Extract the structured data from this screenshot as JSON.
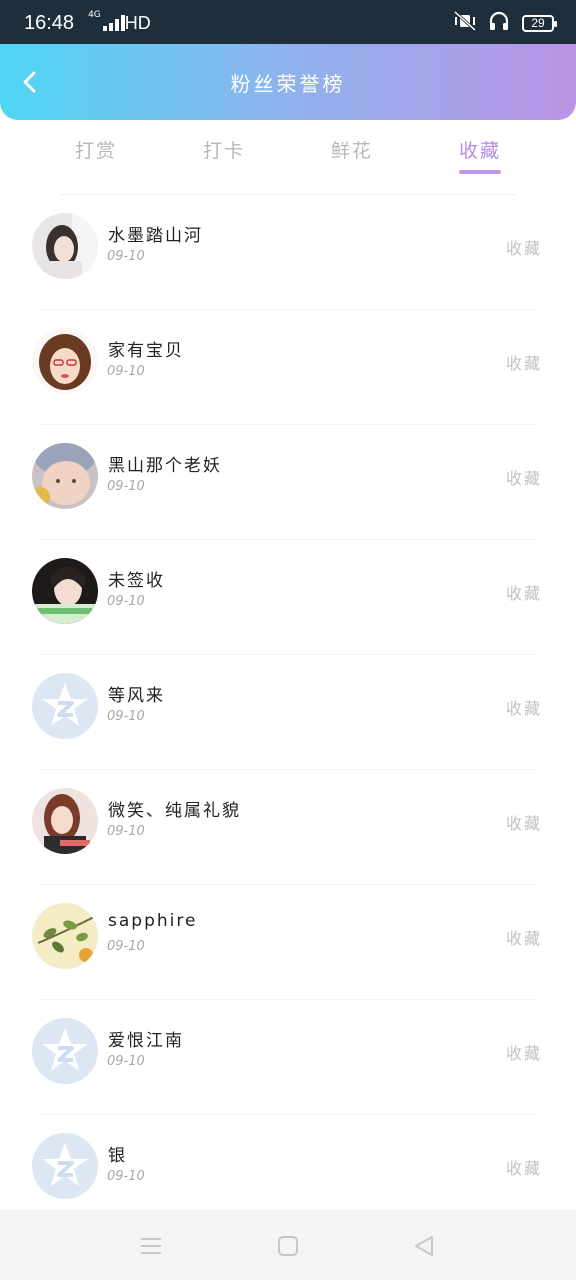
{
  "status_bar": {
    "time": "16:48",
    "network": "4G",
    "hd": "HD",
    "battery": "29"
  },
  "header": {
    "title": "粉丝荣誉榜"
  },
  "tabs": [
    {
      "label": "打赏",
      "active": false
    },
    {
      "label": "打卡",
      "active": false
    },
    {
      "label": "鲜花",
      "active": false
    },
    {
      "label": "收藏",
      "active": true
    }
  ],
  "list": [
    {
      "name": "水墨踏山河",
      "date": "09-10",
      "action": "收藏",
      "avatar": "photo"
    },
    {
      "name": "家有宝贝",
      "date": "09-10",
      "action": "收藏",
      "avatar": "photo"
    },
    {
      "name": "黑山那个老妖",
      "date": "09-10",
      "action": "收藏",
      "avatar": "photo"
    },
    {
      "name": "未签收",
      "date": "09-10",
      "action": "收藏",
      "avatar": "photo"
    },
    {
      "name": "等风来",
      "date": "09-10",
      "action": "收藏",
      "avatar": "default-star"
    },
    {
      "name": "微笑、纯属礼貌",
      "date": "09-10",
      "action": "收藏",
      "avatar": "photo"
    },
    {
      "name": "sapphire",
      "date": "09-10",
      "action": "收藏",
      "avatar": "plant"
    },
    {
      "name": "爱恨江南",
      "date": "09-10",
      "action": "收藏",
      "avatar": "default-star"
    },
    {
      "name": "银",
      "date": "09-10",
      "action": "收藏",
      "avatar": "default-star"
    }
  ],
  "colors": {
    "accent": "#b58be6",
    "header_gradient_start": "#4fd6f3",
    "header_gradient_end": "#bb94e6"
  },
  "icons": {
    "back": "chevron-left-icon",
    "menu": "menu-icon",
    "home": "square-icon",
    "back_nav": "triangle-back-icon"
  }
}
